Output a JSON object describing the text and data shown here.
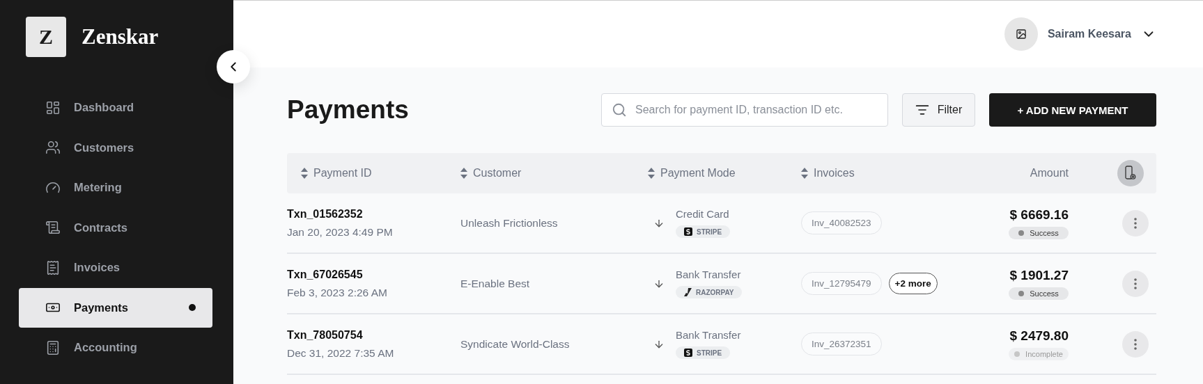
{
  "brand": {
    "initial": "Z",
    "name": "Zenskar"
  },
  "sidebar": {
    "items": [
      {
        "label": "Dashboard",
        "selected": false
      },
      {
        "label": "Customers",
        "selected": false
      },
      {
        "label": "Metering",
        "selected": false
      },
      {
        "label": "Contracts",
        "selected": false
      },
      {
        "label": "Invoices",
        "selected": false
      },
      {
        "label": "Payments",
        "selected": true
      },
      {
        "label": "Accounting",
        "selected": false
      }
    ]
  },
  "user": {
    "name": "Sairam Keesara"
  },
  "page": {
    "title": "Payments",
    "search": {
      "placeholder": "Search for payment ID, transaction ID etc."
    },
    "filter_button": "Filter",
    "add_button": "+ ADD NEW PAYMENT"
  },
  "table": {
    "columns": [
      {
        "label": "Payment ID",
        "sortable": true
      },
      {
        "label": "Customer",
        "sortable": true
      },
      {
        "label": "Payment Mode",
        "sortable": true
      },
      {
        "label": "Invoices",
        "sortable": true
      },
      {
        "label": "Amount",
        "sortable": false
      }
    ],
    "rows": [
      {
        "id": "Txn_01562352",
        "date": "Jan 20, 2023 4:49 PM",
        "customer": "Unleash Frictionless",
        "mode": "Credit Card",
        "gateway": {
          "kind": "stripe",
          "label": "STRIPE"
        },
        "invoices": [
          "Inv_40082523"
        ],
        "more": null,
        "amount": "$ 6669.16",
        "status": {
          "kind": "success",
          "label": "Success"
        }
      },
      {
        "id": "Txn_67026545",
        "date": "Feb 3, 2023 2:26 AM",
        "customer": "E-Enable Best",
        "mode": "Bank Transfer",
        "gateway": {
          "kind": "razorpay",
          "label": "RAZORPAY"
        },
        "invoices": [
          "Inv_12795479"
        ],
        "more": "+2 more",
        "amount": "$ 1901.27",
        "status": {
          "kind": "success",
          "label": "Success"
        }
      },
      {
        "id": "Txn_78050754",
        "date": "Dec 31, 2022 7:35 AM",
        "customer": "Syndicate World-Class",
        "mode": "Bank Transfer",
        "gateway": {
          "kind": "stripe",
          "label": "STRIPE"
        },
        "invoices": [
          "Inv_26372351"
        ],
        "more": null,
        "amount": "$ 2479.80",
        "status": {
          "kind": "incomplete",
          "label": "Incomplete"
        }
      }
    ]
  }
}
